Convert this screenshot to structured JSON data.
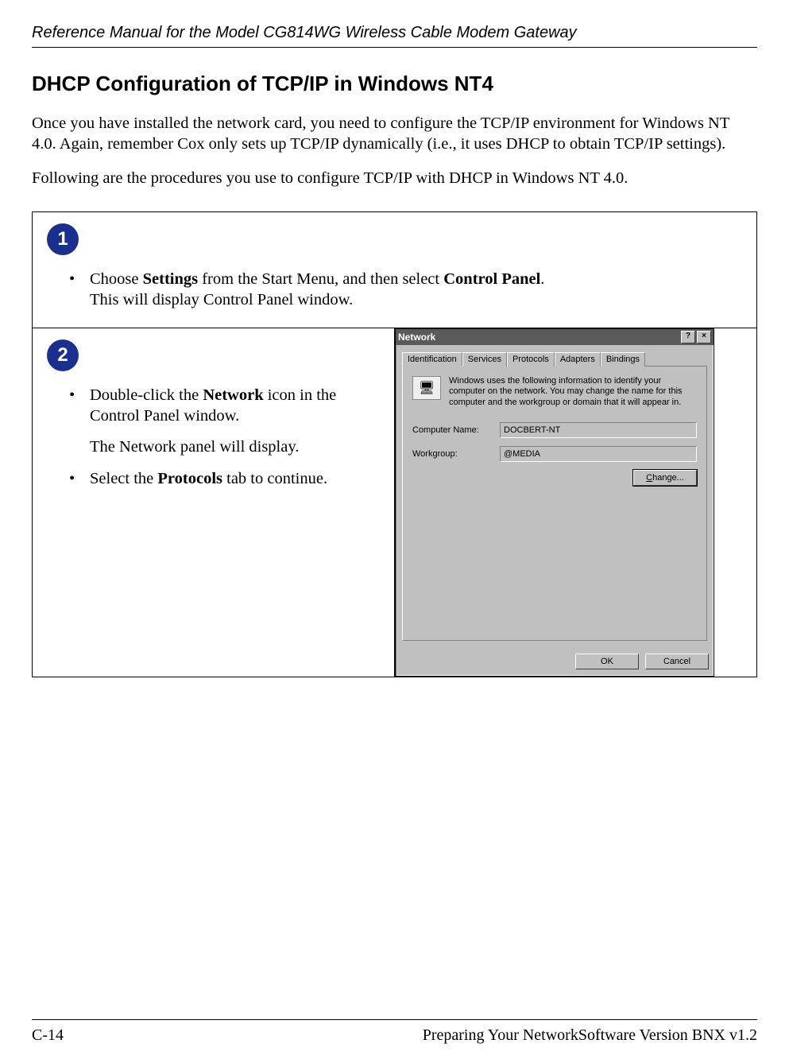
{
  "header": {
    "title": "Reference Manual for the Model CG814WG Wireless Cable Modem Gateway"
  },
  "section": {
    "heading": "DHCP Configuration of TCP/IP in Windows NT4",
    "para1": "Once you have installed the network card, you need to configure the TCP/IP environment for Windows NT 4.0.  Again, remember Cox only sets up TCP/IP dynamically (i.e., it uses DHCP to obtain TCP/IP settings).",
    "para2": "Following are the procedures you use to configure TCP/IP with DHCP in Windows NT 4.0."
  },
  "steps": {
    "step1": {
      "badge": "1",
      "bullet1_pre": "Choose ",
      "bullet1_bold1": "Settings",
      "bullet1_mid": " from the Start Menu, and then select ",
      "bullet1_bold2": "Control Panel",
      "bullet1_post": ".",
      "bullet1_line2": "This will display Control Panel window."
    },
    "step2": {
      "badge": "2",
      "bullet1_pre": "Double-click the ",
      "bullet1_bold": "Network",
      "bullet1_post": " icon in the Control Panel window.",
      "subtext": "The Network panel will display.",
      "bullet2_pre": "Select the ",
      "bullet2_bold": "Protocols",
      "bullet2_post": " tab to continue."
    }
  },
  "dialog": {
    "title": "Network",
    "help_btn": "?",
    "close_btn": "×",
    "tabs": [
      "Identification",
      "Services",
      "Protocols",
      "Adapters",
      "Bindings"
    ],
    "info": "Windows uses the following information to identify your computer on the network.  You may change the name for this computer and the workgroup or domain that it will appear in.",
    "computer_name_label": "Computer Name:",
    "computer_name_value": "DOCBERT-NT",
    "workgroup_label": "Workgroup:",
    "workgroup_value": "@MEDIA",
    "change_button": "Change...",
    "ok_button": "OK",
    "cancel_button": "Cancel"
  },
  "footer": {
    "left": "C-14",
    "right": "Preparing Your NetworkSoftware Version BNX v1.2"
  }
}
